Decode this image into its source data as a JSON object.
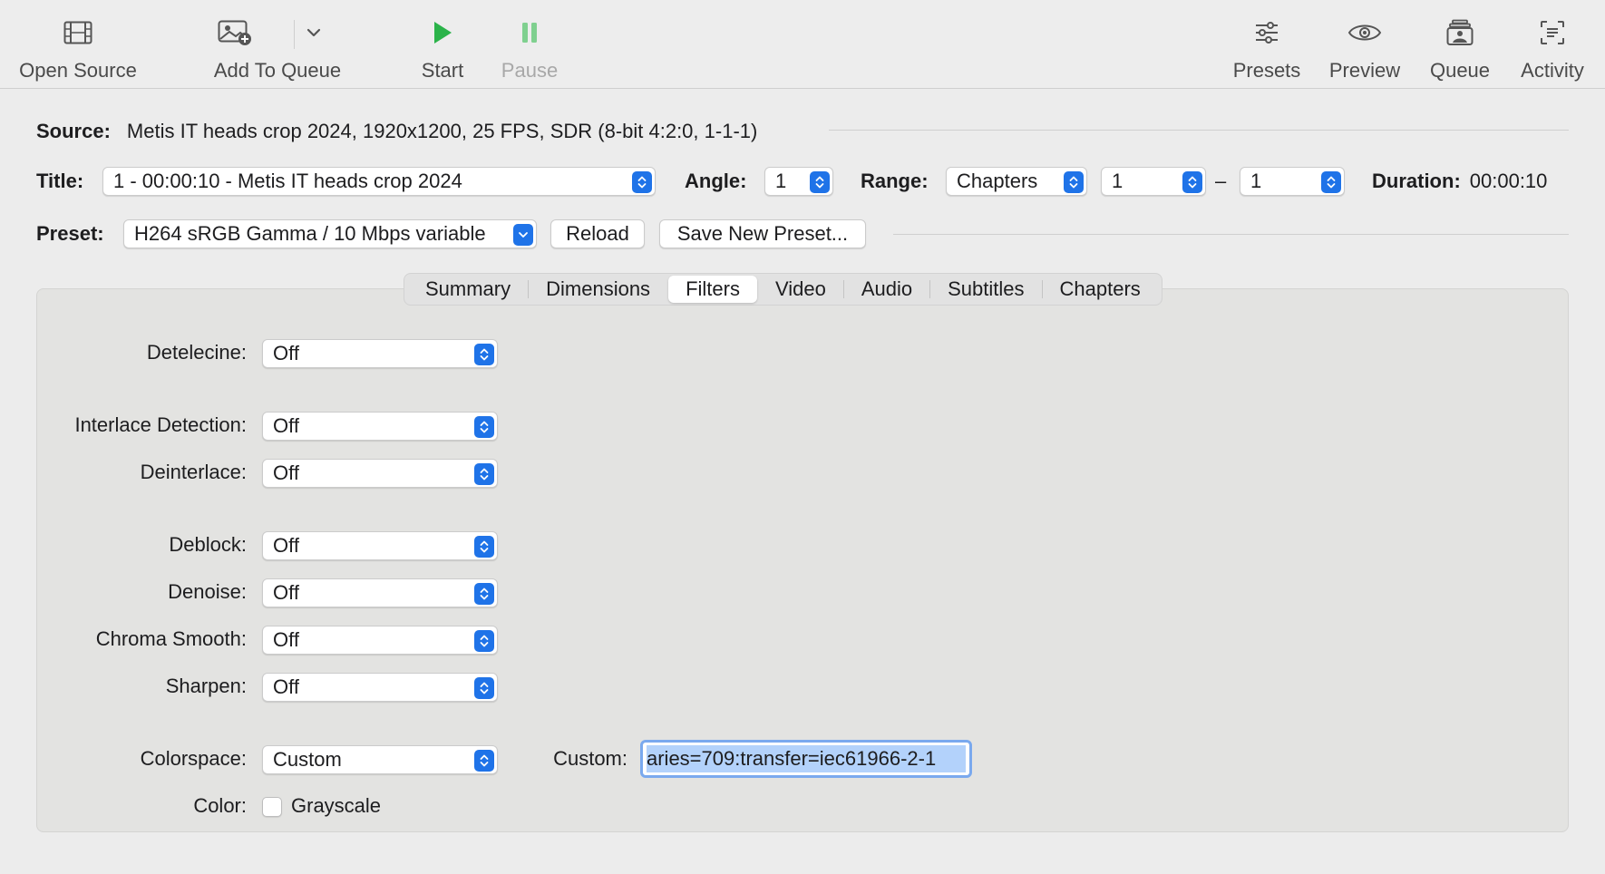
{
  "toolbar": {
    "open_source": "Open Source",
    "add_to_queue": "Add To Queue",
    "start": "Start",
    "pause": "Pause",
    "presets": "Presets",
    "preview": "Preview",
    "queue": "Queue",
    "activity": "Activity",
    "colors": {
      "start": "#2bb34a",
      "pause": "#7fd08f"
    }
  },
  "source": {
    "label": "Source:",
    "value": "Metis IT heads crop 2024, 1920x1200, 25 FPS, SDR (8-bit 4:2:0, 1-1-1)"
  },
  "title_row": {
    "title_label": "Title:",
    "title_value": "1 - 00:00:10 - Metis IT heads crop 2024",
    "angle_label": "Angle:",
    "angle_value": "1",
    "range_label": "Range:",
    "range_type": "Chapters",
    "range_start": "1",
    "range_sep": "–",
    "range_end": "1",
    "duration_label": "Duration:",
    "duration_value": "00:00:10"
  },
  "preset_row": {
    "label": "Preset:",
    "value": "H264 sRGB Gamma / 10 Mbps variable",
    "reload": "Reload",
    "save_new": "Save New Preset..."
  },
  "tabs": [
    {
      "label": "Summary",
      "active": false
    },
    {
      "label": "Dimensions",
      "active": false
    },
    {
      "label": "Filters",
      "active": true
    },
    {
      "label": "Video",
      "active": false
    },
    {
      "label": "Audio",
      "active": false
    },
    {
      "label": "Subtitles",
      "active": false
    },
    {
      "label": "Chapters",
      "active": false
    }
  ],
  "filters": {
    "detelecine": {
      "label": "Detelecine:",
      "value": "Off"
    },
    "interlace_detection": {
      "label": "Interlace Detection:",
      "value": "Off"
    },
    "deinterlace": {
      "label": "Deinterlace:",
      "value": "Off"
    },
    "deblock": {
      "label": "Deblock:",
      "value": "Off"
    },
    "denoise": {
      "label": "Denoise:",
      "value": "Off"
    },
    "chroma_smooth": {
      "label": "Chroma Smooth:",
      "value": "Off"
    },
    "sharpen": {
      "label": "Sharpen:",
      "value": "Off"
    },
    "colorspace": {
      "label": "Colorspace:",
      "value": "Custom"
    },
    "custom": {
      "label": "Custom:",
      "value": "aries=709:transfer=iec61966-2-1"
    },
    "color": {
      "label": "Color:",
      "grayscale_label": "Grayscale",
      "grayscale_checked": false
    }
  },
  "accent_color": "#1f73e8"
}
